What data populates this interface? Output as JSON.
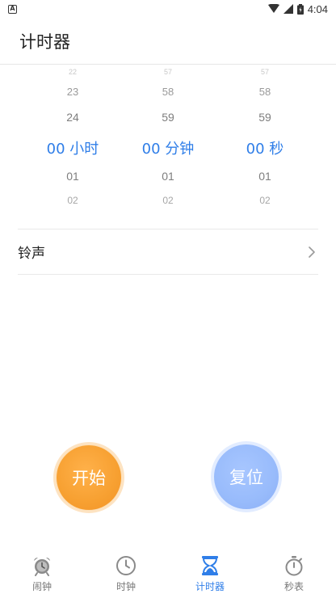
{
  "status_bar": {
    "time": "4:04",
    "notification_badge": "A"
  },
  "app_bar": {
    "title": "计时器"
  },
  "picker": {
    "hours": [
      "22",
      "23",
      "24",
      "00 小时",
      "01",
      "02"
    ],
    "minutes": [
      "57",
      "58",
      "59",
      "00 分钟",
      "01",
      "02"
    ],
    "seconds": [
      "57",
      "58",
      "59",
      "00 秒",
      "01",
      "02"
    ],
    "selected_color": "#2f7ee8"
  },
  "ringtone": {
    "label": "铃声"
  },
  "buttons": {
    "start_label": "开始",
    "reset_label": "复位",
    "start_color": "#f7a031",
    "reset_color": "#98bbfb"
  },
  "tabs": [
    {
      "label": "闹钟",
      "icon": "alarm-clock-icon"
    },
    {
      "label": "时钟",
      "icon": "clock-icon"
    },
    {
      "label": "计时器",
      "icon": "hourglass-icon"
    },
    {
      "label": "秒表",
      "icon": "stopwatch-icon"
    }
  ],
  "active_tab": "计时器"
}
